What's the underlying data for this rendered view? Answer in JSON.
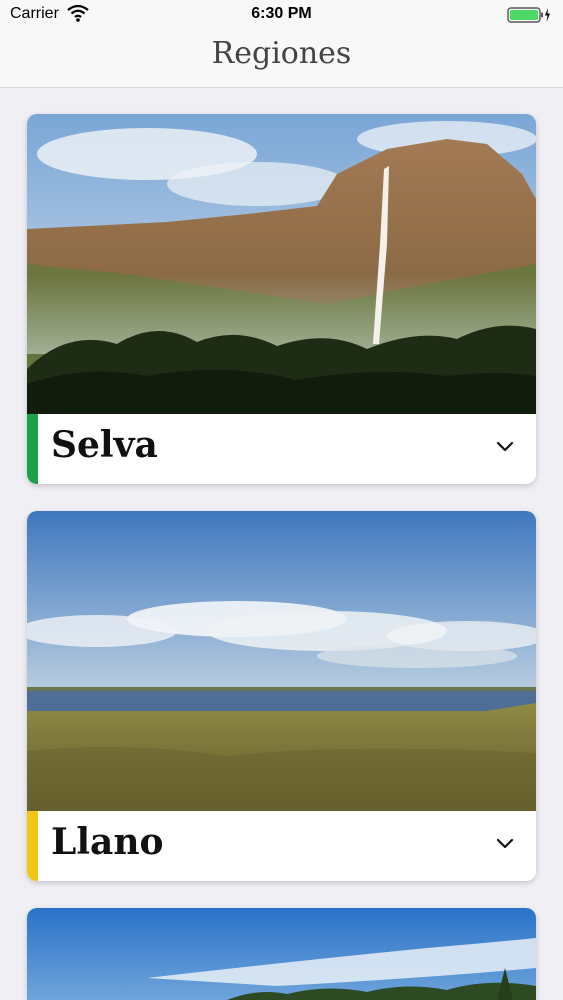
{
  "status": {
    "carrier": "Carrier",
    "time": "6:30 PM"
  },
  "header": {
    "title": "Regiones"
  },
  "regions": [
    {
      "name": "Selva",
      "accent_color": "#1aa24a",
      "icon": "chevron-down-icon"
    },
    {
      "name": "Llano",
      "accent_color": "#f2c613",
      "icon": "chevron-down-icon"
    }
  ],
  "colors": {
    "battery": "#4cd964",
    "background": "#efeff4"
  }
}
